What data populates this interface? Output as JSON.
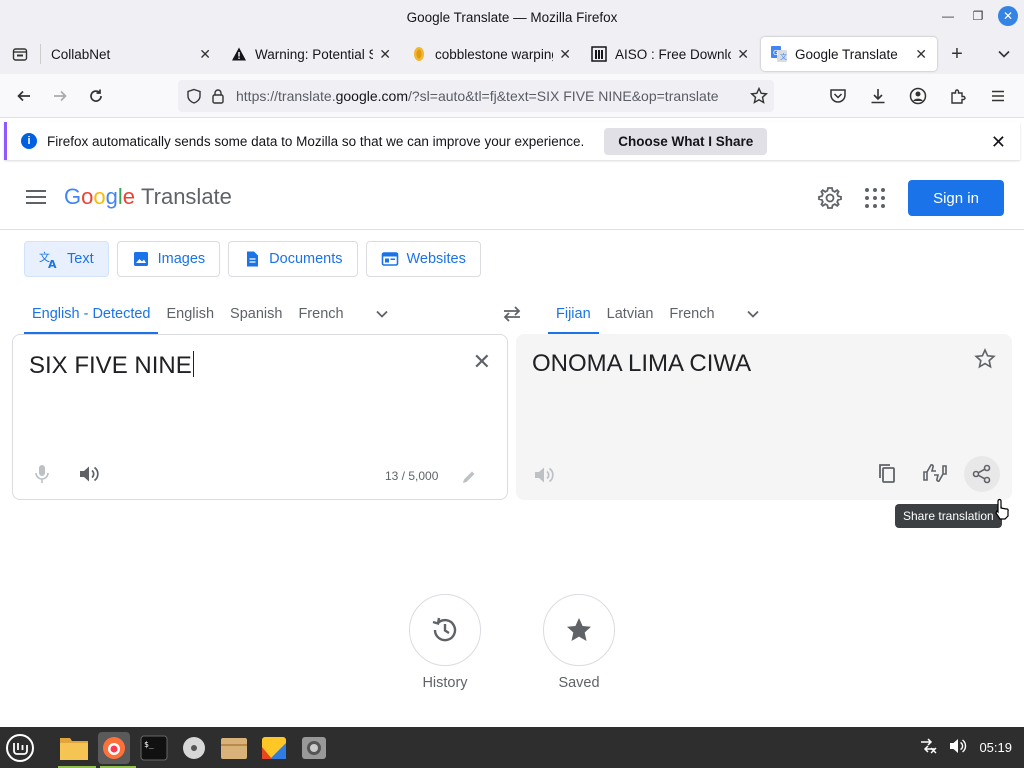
{
  "window": {
    "title": "Google Translate — Mozilla Firefox"
  },
  "tabs": [
    {
      "title": "CollabNet",
      "favicon": "none"
    },
    {
      "title": "Warning: Potential Se",
      "favicon": "warning-icon"
    },
    {
      "title": "cobblestone warping",
      "favicon": "coin-icon"
    },
    {
      "title": "AISO : Free Downloa",
      "favicon": "building-icon"
    },
    {
      "title": "Google Translate",
      "favicon": "google-translate-icon",
      "active": true
    }
  ],
  "navbar": {
    "url_prefix": "https://translate.",
    "url_host": "google.com",
    "url_rest": "/?sl=auto&tl=fj&text=SIX FIVE NINE&op=translate"
  },
  "notification": {
    "message": "Firefox automatically sends some data to Mozilla so that we can improve your experience.",
    "button": "Choose What I Share"
  },
  "gt": {
    "logo_google": [
      "G",
      "o",
      "o",
      "g",
      "l",
      "e"
    ],
    "logo_colors": [
      "#4285f4",
      "#ea4335",
      "#fbbc05",
      "#4285f4",
      "#34a853",
      "#ea4335"
    ],
    "logo_translate": "Translate",
    "signin": "Sign in",
    "modes": [
      "Text",
      "Images",
      "Documents",
      "Websites"
    ],
    "source_langs": [
      "English - Detected",
      "English",
      "Spanish",
      "French"
    ],
    "target_langs": [
      "Fijian",
      "Latvian",
      "French"
    ],
    "source_text": "SIX FIVE NINE",
    "char_count": "13 / 5,000",
    "target_text": "ONOMA LIMA CIWA",
    "tooltip": "Share translation",
    "history": "History",
    "saved": "Saved"
  },
  "taskbar": {
    "time": "05:19"
  },
  "colors": {
    "accent": "#1a73e8",
    "firefox_accent": "#9059ff"
  }
}
